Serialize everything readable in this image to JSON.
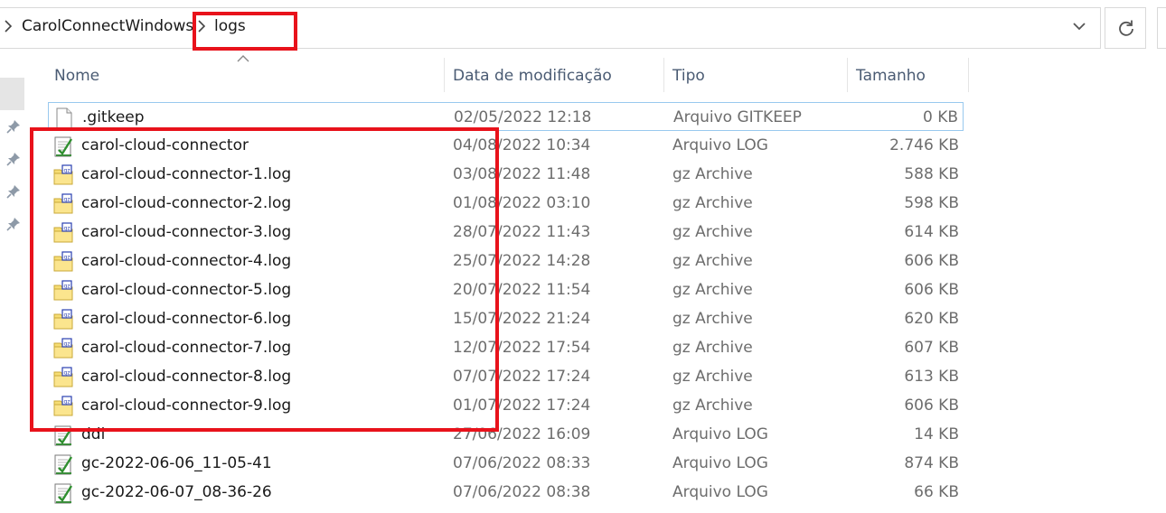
{
  "breadcrumb": {
    "items": [
      {
        "label": "CarolConnectWindows"
      },
      {
        "label": "logs"
      }
    ]
  },
  "columns": {
    "name": "Nome",
    "date": "Data de modificação",
    "type": "Tipo",
    "size": "Tamanho"
  },
  "files": [
    {
      "name": ".gitkeep",
      "date": "02/05/2022 12:18",
      "type": "Arquivo GITKEEP",
      "size": "0 KB",
      "icon": "blank-file-icon"
    },
    {
      "name": "carol-cloud-connector",
      "date": "04/08/2022 10:34",
      "type": "Arquivo LOG",
      "size": "2.746 KB",
      "icon": "log-file-icon"
    },
    {
      "name": "carol-cloud-connector-1.log",
      "date": "03/08/2022 11:48",
      "type": "gz Archive",
      "size": "588 KB",
      "icon": "gz-archive-icon"
    },
    {
      "name": "carol-cloud-connector-2.log",
      "date": "01/08/2022 03:10",
      "type": "gz Archive",
      "size": "598 KB",
      "icon": "gz-archive-icon"
    },
    {
      "name": "carol-cloud-connector-3.log",
      "date": "28/07/2022 11:43",
      "type": "gz Archive",
      "size": "614 KB",
      "icon": "gz-archive-icon"
    },
    {
      "name": "carol-cloud-connector-4.log",
      "date": "25/07/2022 14:28",
      "type": "gz Archive",
      "size": "606 KB",
      "icon": "gz-archive-icon"
    },
    {
      "name": "carol-cloud-connector-5.log",
      "date": "20/07/2022 11:54",
      "type": "gz Archive",
      "size": "606 KB",
      "icon": "gz-archive-icon"
    },
    {
      "name": "carol-cloud-connector-6.log",
      "date": "15/07/2022 21:24",
      "type": "gz Archive",
      "size": "620 KB",
      "icon": "gz-archive-icon"
    },
    {
      "name": "carol-cloud-connector-7.log",
      "date": "12/07/2022 17:54",
      "type": "gz Archive",
      "size": "607 KB",
      "icon": "gz-archive-icon"
    },
    {
      "name": "carol-cloud-connector-8.log",
      "date": "07/07/2022 17:24",
      "type": "gz Archive",
      "size": "613 KB",
      "icon": "gz-archive-icon"
    },
    {
      "name": "carol-cloud-connector-9.log",
      "date": "01/07/2022 17:24",
      "type": "gz Archive",
      "size": "606 KB",
      "icon": "gz-archive-icon"
    },
    {
      "name": "ddl",
      "date": "27/06/2022 16:09",
      "type": "Arquivo LOG",
      "size": "14 KB",
      "icon": "log-file-icon"
    },
    {
      "name": "gc-2022-06-06_11-05-41",
      "date": "07/06/2022 08:33",
      "type": "Arquivo LOG",
      "size": "874 KB",
      "icon": "log-file-icon"
    },
    {
      "name": "gc-2022-06-07_08-36-26",
      "date": "07/06/2022 08:38",
      "type": "Arquivo LOG",
      "size": "66 KB",
      "icon": "log-file-icon"
    }
  ],
  "colors": {
    "highlight": "#e8121b",
    "selection_border": "#99c9ef",
    "header_text": "#4a5b73"
  }
}
